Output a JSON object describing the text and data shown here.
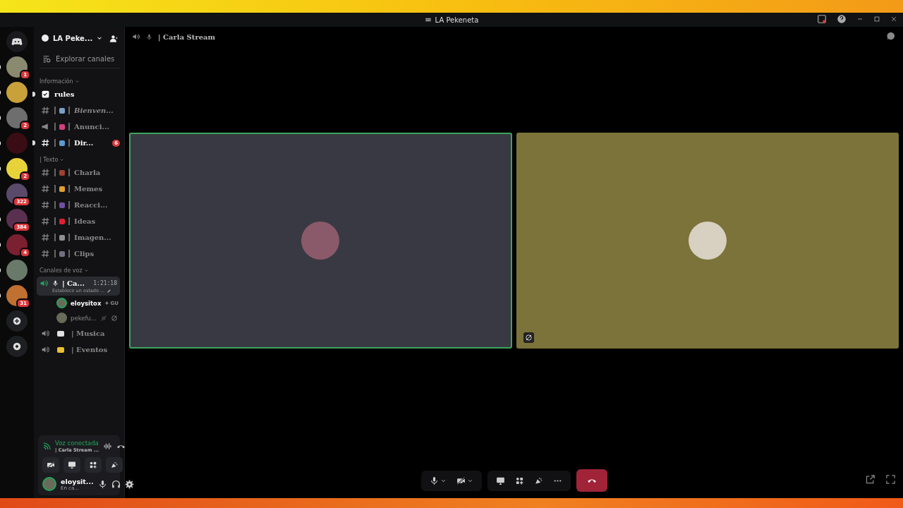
{
  "window": {
    "title": "LA Pekeneta"
  },
  "servers": [
    {
      "badge": "1",
      "unread": true,
      "color": "#8a8a70"
    },
    {
      "unread": true,
      "color": "#c9a13a"
    },
    {
      "badge": "2",
      "unread": true,
      "color": "#6e6e6e"
    },
    {
      "unread": true,
      "color": "#3a0d14"
    },
    {
      "badge": "2",
      "unread": true,
      "color": "#e8d23a"
    },
    {
      "badge": "322",
      "unread": false,
      "color": "#5a4a6a"
    },
    {
      "badge": "384",
      "unread": true,
      "color": "#5a3050"
    },
    {
      "badge": "4",
      "unread": true,
      "color": "#7a2030"
    },
    {
      "unread": true,
      "color": "#6a7a6a"
    },
    {
      "badge": "31",
      "unread": true,
      "color": "#c07030"
    }
  ],
  "sidebar": {
    "server_name": "LA Peke...",
    "explore": "Explorar canales",
    "sections": [
      {
        "kind": "category",
        "label": "Información"
      },
      {
        "kind": "rules",
        "label": "rules",
        "unread": true
      },
      {
        "kind": "text",
        "label": "Bienven...",
        "unread": false,
        "italic": true,
        "color": "#7aa0c8"
      },
      {
        "kind": "announcement",
        "label": "Anunci...",
        "unread": false,
        "color": "#d04080"
      },
      {
        "kind": "text",
        "label": "Dir...",
        "unread": true,
        "mentions": "6",
        "color": "#5a9ad0"
      },
      {
        "kind": "category",
        "label": "| Texto"
      },
      {
        "kind": "text",
        "label": "Charla",
        "unread": false,
        "color": "#a04030"
      },
      {
        "kind": "text",
        "label": "Memes",
        "unread": false,
        "color": "#e0a030"
      },
      {
        "kind": "text",
        "label": "Reacci...",
        "unread": false,
        "color": "#7050a0"
      },
      {
        "kind": "text",
        "label": "Ideas",
        "unread": false,
        "color": "#e02030"
      },
      {
        "kind": "text",
        "label": "Imagen...",
        "unread": false,
        "color": "#909090"
      },
      {
        "kind": "text",
        "label": "Clips",
        "unread": false,
        "color": "#707080"
      },
      {
        "kind": "category",
        "label": "Canales de voz"
      },
      {
        "kind": "voice_active",
        "label": "| Ca...",
        "time": "1:21:18",
        "status": "Establece un estado ...",
        "users": [
          {
            "name": "eloysitox",
            "speaking": true,
            "tag": "GU"
          },
          {
            "name": "pekefu...",
            "speaking": false
          }
        ]
      },
      {
        "kind": "voice",
        "label": "| Musica",
        "color": "#e0e0e0"
      },
      {
        "kind": "voice",
        "label": "| Eventos",
        "color": "#e8c030"
      }
    ]
  },
  "voice_panel": {
    "status": "Voz conectada",
    "channel": "| Carla Stream ..."
  },
  "user": {
    "name": "eloysit...",
    "status": "En ca..."
  },
  "header": {
    "channel": "| Carla Stream"
  },
  "tiles": [
    {
      "speaking": true,
      "muted": false,
      "color": "#393943"
    },
    {
      "speaking": false,
      "muted": true,
      "color": "#7b7339"
    }
  ]
}
